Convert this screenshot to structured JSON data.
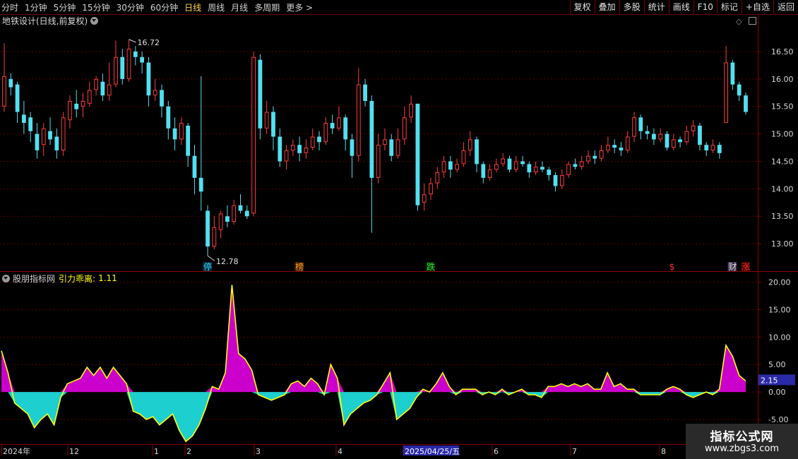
{
  "toolbar": {
    "periods": [
      "分时",
      "1分钟",
      "5分钟",
      "15分钟",
      "30分钟",
      "60分钟",
      "日线",
      "周线",
      "月线",
      "多周期",
      "更多"
    ],
    "active_period": "日线",
    "more_arrow": ">",
    "right_buttons": [
      "复权",
      "叠加",
      "多股",
      "统计",
      "画线",
      "F10",
      "标记",
      "+自选",
      "返回"
    ]
  },
  "main_panel": {
    "title": "地铁设计(日线,前复权)",
    "ctrl_diamond": "◇",
    "high_label": "16.72",
    "low_label": "12.78",
    "price_ticks": [
      "16.50",
      "16.00",
      "15.50",
      "15.00",
      "14.50",
      "14.00",
      "13.50",
      "13.00"
    ],
    "markers": [
      {
        "text": "停",
        "color": "#35d6ff",
        "bg": "#0a2a3a"
      },
      {
        "text": "榜",
        "color": "#ff9a2a",
        "bg": "#3a1e00"
      },
      {
        "text": "跌",
        "color": "#33dd33",
        "bg": "#002a00"
      },
      {
        "text": "$",
        "color": "#ff3030",
        "bg": "#000000"
      },
      {
        "text": "财",
        "color": "#e0e0e0",
        "bg": "#3a2a4a"
      },
      {
        "text": "涨",
        "color": "#ff3030",
        "bg": "#3a0000"
      }
    ]
  },
  "indicator_panel": {
    "source": "股朋指标网",
    "name": "引力乖离:",
    "value": "1.11",
    "ticks": [
      "20.00",
      "15.00",
      "10.00",
      "5.00",
      "0.00",
      "-5.00"
    ],
    "last_value": "2.15"
  },
  "time_axis": [
    "2024年",
    "12",
    "1",
    "2",
    "3",
    "4",
    "2025/04/25/五",
    "6",
    "7",
    "8"
  ],
  "watermark": {
    "line1": "指标公式网",
    "line2": "www.zbgs3.com"
  },
  "colors": {
    "up": "#ff3b3b",
    "down": "#52e0f0",
    "frame": "#8a0000",
    "grid": "#5a0000",
    "osc_pos": "#cc00cc",
    "osc_neg": "#1ecfcf",
    "osc_line": "#ffff00",
    "axis_text": "#d8d8d8",
    "accent": "#ffd24a",
    "highlight_bg": "#2a2aa8"
  },
  "chart_data": [
    {
      "type": "candlestick",
      "y_range": [
        12.68,
        16.95
      ],
      "candles": [
        [
          15.5,
          16.05,
          16.65,
          15.4
        ],
        [
          16.0,
          15.85,
          16.1,
          15.7
        ],
        [
          15.9,
          15.4,
          15.95,
          15.2
        ],
        [
          15.35,
          15.2,
          15.6,
          15.0
        ],
        [
          15.3,
          15.05,
          15.4,
          14.85
        ],
        [
          15.0,
          14.7,
          15.2,
          14.55
        ],
        [
          14.8,
          15.1,
          15.2,
          14.6
        ],
        [
          15.05,
          14.9,
          15.3,
          14.8
        ],
        [
          14.95,
          14.7,
          15.1,
          14.55
        ],
        [
          14.7,
          15.3,
          15.4,
          14.6
        ],
        [
          15.25,
          15.6,
          15.7,
          15.1
        ],
        [
          15.55,
          15.45,
          15.8,
          15.3
        ],
        [
          15.5,
          15.6,
          15.75,
          15.3
        ],
        [
          15.55,
          15.8,
          15.95,
          15.5
        ],
        [
          15.8,
          16.0,
          16.05,
          15.7
        ],
        [
          15.95,
          15.7,
          16.1,
          15.6
        ],
        [
          15.7,
          15.9,
          16.3,
          15.6
        ],
        [
          15.9,
          16.4,
          16.7,
          15.85
        ],
        [
          16.4,
          16.0,
          16.55,
          15.9
        ],
        [
          16.0,
          16.55,
          16.72,
          15.95
        ],
        [
          16.5,
          16.4,
          16.6,
          16.25
        ],
        [
          16.4,
          16.3,
          16.5,
          16.1
        ],
        [
          16.3,
          15.7,
          16.4,
          15.5
        ],
        [
          15.7,
          15.8,
          16.0,
          15.6
        ],
        [
          15.8,
          15.5,
          15.9,
          15.3
        ],
        [
          15.5,
          15.1,
          15.6,
          14.9
        ],
        [
          15.1,
          14.9,
          15.3,
          14.7
        ],
        [
          14.9,
          15.2,
          15.3,
          14.8
        ],
        [
          15.15,
          14.6,
          15.2,
          14.4
        ],
        [
          14.6,
          14.2,
          14.8,
          13.9
        ],
        [
          14.2,
          13.95,
          16.05,
          13.6
        ],
        [
          13.6,
          12.95,
          13.7,
          12.78
        ],
        [
          12.95,
          13.3,
          13.5,
          12.9
        ],
        [
          13.25,
          13.55,
          13.6,
          13.1
        ],
        [
          13.5,
          13.4,
          13.7,
          13.3
        ],
        [
          13.4,
          13.7,
          13.8,
          13.35
        ],
        [
          13.7,
          13.6,
          13.9,
          13.55
        ],
        [
          13.6,
          13.5,
          13.7,
          13.45
        ],
        [
          13.55,
          16.4,
          16.5,
          13.5
        ],
        [
          16.35,
          15.1,
          16.45,
          14.9
        ],
        [
          15.1,
          15.4,
          15.6,
          15.0
        ],
        [
          15.4,
          14.95,
          15.5,
          14.7
        ],
        [
          14.95,
          14.5,
          15.1,
          14.4
        ],
        [
          14.5,
          14.7,
          14.8,
          14.35
        ],
        [
          14.7,
          14.8,
          14.9,
          14.6
        ],
        [
          14.8,
          14.65,
          14.95,
          14.5
        ],
        [
          14.65,
          14.75,
          14.9,
          14.55
        ],
        [
          14.75,
          14.95,
          15.1,
          14.7
        ],
        [
          14.95,
          14.85,
          15.05,
          14.7
        ],
        [
          14.85,
          15.2,
          15.3,
          14.8
        ],
        [
          15.2,
          15.1,
          15.35,
          15.0
        ],
        [
          15.1,
          15.3,
          15.5,
          15.05
        ],
        [
          15.3,
          14.9,
          15.35,
          14.7
        ],
        [
          14.9,
          14.6,
          15.0,
          14.2
        ],
        [
          14.6,
          15.9,
          16.2,
          14.5
        ],
        [
          15.9,
          15.6,
          16.0,
          15.5
        ],
        [
          15.6,
          14.2,
          15.7,
          13.2
        ],
        [
          14.2,
          14.8,
          15.0,
          14.1
        ],
        [
          14.8,
          14.9,
          15.1,
          14.7
        ],
        [
          14.9,
          14.6,
          15.0,
          14.5
        ],
        [
          14.6,
          14.9,
          15.1,
          14.55
        ],
        [
          14.9,
          15.3,
          15.5,
          14.8
        ],
        [
          15.3,
          15.55,
          15.7,
          15.2
        ],
        [
          15.55,
          13.7,
          14.4,
          13.6
        ],
        [
          13.75,
          13.9,
          14.1,
          13.6
        ],
        [
          13.9,
          14.1,
          14.2,
          13.8
        ],
        [
          14.1,
          14.3,
          14.4,
          14.0
        ],
        [
          14.3,
          14.5,
          14.6,
          14.2
        ],
        [
          14.5,
          14.35,
          14.6,
          14.2
        ],
        [
          14.35,
          14.45,
          14.55,
          14.3
        ],
        [
          14.45,
          14.7,
          14.85,
          14.4
        ],
        [
          14.7,
          14.9,
          15.05,
          14.6
        ],
        [
          14.9,
          14.45,
          14.95,
          14.3
        ],
        [
          14.45,
          14.2,
          14.5,
          14.1
        ],
        [
          14.2,
          14.35,
          14.45,
          14.15
        ],
        [
          14.35,
          14.45,
          14.55,
          14.3
        ],
        [
          14.45,
          14.55,
          14.65,
          14.4
        ],
        [
          14.55,
          14.35,
          14.6,
          14.3
        ],
        [
          14.35,
          14.5,
          14.6,
          14.3
        ],
        [
          14.5,
          14.45,
          14.6,
          14.4
        ],
        [
          14.45,
          14.3,
          14.5,
          14.2
        ],
        [
          14.3,
          14.4,
          14.5,
          14.25
        ],
        [
          14.4,
          14.35,
          14.5,
          14.3
        ],
        [
          14.35,
          14.25,
          14.4,
          14.15
        ],
        [
          14.25,
          14.05,
          14.3,
          13.95
        ],
        [
          14.05,
          14.25,
          14.35,
          14.0
        ],
        [
          14.25,
          14.45,
          14.5,
          14.2
        ],
        [
          14.45,
          14.4,
          14.55,
          14.35
        ],
        [
          14.4,
          14.5,
          14.6,
          14.35
        ],
        [
          14.5,
          14.6,
          14.7,
          14.45
        ],
        [
          14.6,
          14.55,
          14.7,
          14.45
        ],
        [
          14.55,
          14.7,
          14.8,
          14.5
        ],
        [
          14.7,
          14.8,
          14.95,
          14.65
        ],
        [
          14.8,
          14.75,
          14.9,
          14.65
        ],
        [
          14.75,
          14.7,
          14.85,
          14.6
        ],
        [
          14.7,
          14.95,
          15.05,
          14.65
        ],
        [
          14.95,
          15.3,
          15.4,
          14.85
        ],
        [
          15.3,
          15.05,
          15.35,
          14.9
        ],
        [
          15.05,
          15.0,
          15.15,
          14.9
        ],
        [
          15.0,
          14.9,
          15.1,
          14.8
        ],
        [
          14.9,
          15.0,
          15.1,
          14.85
        ],
        [
          15.0,
          14.75,
          15.05,
          14.7
        ],
        [
          14.75,
          14.9,
          15.0,
          14.7
        ],
        [
          14.9,
          14.85,
          14.95,
          14.75
        ],
        [
          14.85,
          15.05,
          15.15,
          14.8
        ],
        [
          15.05,
          15.15,
          15.25,
          14.95
        ],
        [
          15.15,
          14.8,
          15.2,
          14.7
        ],
        [
          14.8,
          14.7,
          14.85,
          14.6
        ],
        [
          14.7,
          14.8,
          14.9,
          14.65
        ],
        [
          14.8,
          14.65,
          14.85,
          14.55
        ],
        [
          15.2,
          16.3,
          16.6,
          15.2
        ],
        [
          16.3,
          15.9,
          16.35,
          15.8
        ],
        [
          15.9,
          15.7,
          15.95,
          15.6
        ],
        [
          15.7,
          15.4,
          15.75,
          15.35
        ]
      ]
    },
    {
      "type": "area",
      "y_range": [
        -9.5,
        22.0
      ],
      "values": [
        7.5,
        3.5,
        -2.0,
        -3.0,
        -4.0,
        -6.5,
        -5.0,
        -4.0,
        -6.0,
        -1.0,
        1.5,
        2.0,
        2.5,
        4.5,
        3.0,
        4.5,
        2.5,
        4.5,
        3.0,
        1.5,
        -3.5,
        -4.0,
        -5.0,
        -4.5,
        -6.0,
        -5.0,
        -4.0,
        -7.0,
        -9.0,
        -8.0,
        -6.0,
        -3.0,
        1.0,
        0.5,
        3.5,
        19.5,
        7.0,
        6.0,
        4.0,
        -0.5,
        -1.0,
        -1.5,
        -1.0,
        -0.5,
        1.5,
        2.0,
        1.0,
        2.5,
        1.5,
        -0.5,
        5.0,
        2.5,
        -6.0,
        -4.0,
        -3.0,
        -2.0,
        -1.5,
        -0.5,
        1.5,
        3.5,
        -5.0,
        -4.0,
        -3.0,
        -1.0,
        0.5,
        0.0,
        1.5,
        3.5,
        1.0,
        -0.5,
        0.5,
        0.5,
        0.5,
        -0.5,
        0.0,
        -0.5,
        0.5,
        -0.5,
        0.0,
        0.5,
        -0.5,
        -0.5,
        -1.0,
        1.0,
        1.0,
        1.5,
        1.0,
        1.5,
        1.0,
        1.5,
        0.5,
        0.5,
        3.5,
        1.0,
        1.5,
        0.5,
        0.5,
        -0.5,
        -0.5,
        -0.5,
        -0.5,
        0.5,
        1.0,
        0.5,
        -0.5,
        -1.0,
        -0.5,
        0.0,
        -0.5,
        0.5,
        8.5,
        6.5,
        3.0,
        2.0
      ]
    }
  ]
}
